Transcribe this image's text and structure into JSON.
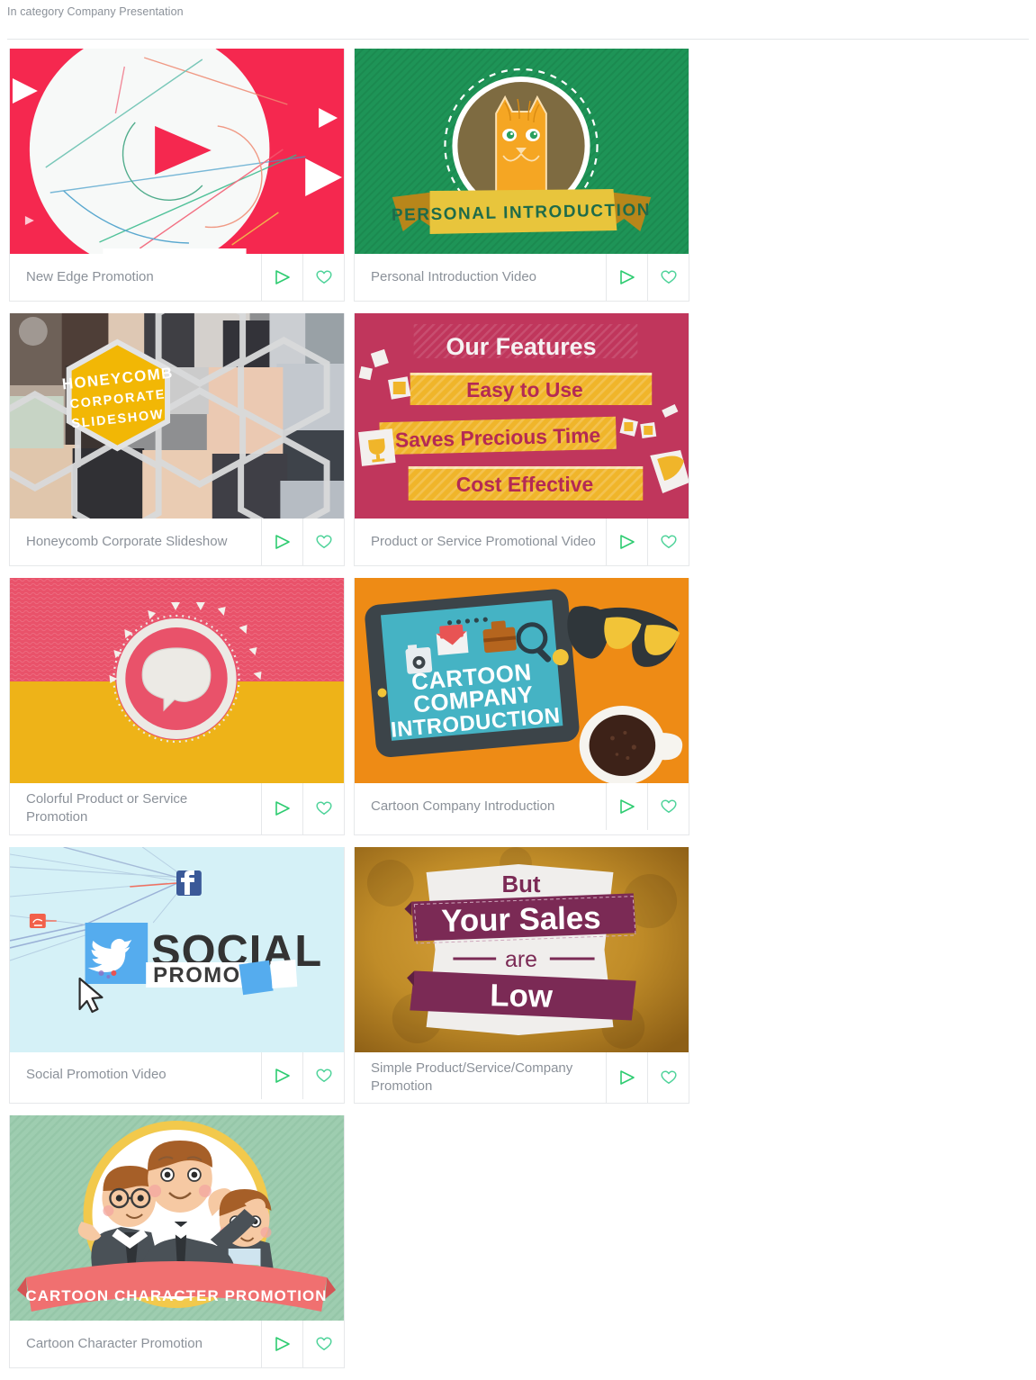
{
  "header": {
    "category_label": "In category Company Presentation"
  },
  "actions": {
    "play_icon": "play-icon",
    "favorite_icon": "heart-icon",
    "play_color": "#2ecc71",
    "heart_color": "#4fd39a"
  },
  "theme": {
    "title_color": "#8b9199",
    "border_color": "#e6e8ea",
    "background": "#ffffff"
  },
  "cards": [
    {
      "title": "New Edge Promotion",
      "art": "new-edge-promotion-thumbnail",
      "colors": {
        "bg": "#f5284f",
        "circle": "#f7f9f8",
        "play": "#f5284f"
      },
      "art_text": []
    },
    {
      "title": "Personal Introduction Video",
      "art": "personal-introduction-thumbnail",
      "colors": {
        "bg": "#1e9457",
        "disc": "#7e6b41",
        "cat": "#f5a623",
        "banner": "#e8c53c"
      },
      "art_text": [
        "PERSONAL INTRODUCTION"
      ]
    },
    {
      "title": "Honeycomb Corporate Slideshow",
      "art": "honeycomb-corporate-thumbnail",
      "colors": {
        "bg": "#8d8f92",
        "hex": "#f2b705",
        "cell_border": "#d9dadb"
      },
      "art_text": [
        "HONEYCOMB",
        "CORPORATE",
        "SLIDESHOW"
      ]
    },
    {
      "title": "Product or Service Promotional Video",
      "art": "product-service-promotional-thumbnail",
      "colors": {
        "bg": "#c0365c",
        "bar": "#f0b52a",
        "heading": "#f4f1f2",
        "bar_text": "#b42a54"
      },
      "art_text": [
        "Our Features",
        "Easy to Use",
        "Saves Precious Time",
        "Cost Effective"
      ]
    },
    {
      "title": "Colorful Product or Service Promotion",
      "art": "colorful-product-service-thumbnail",
      "colors": {
        "top": "#e9526a",
        "bottom": "#eeb318",
        "ring": "#eceae5",
        "bubble": "#e8e7e2"
      },
      "art_text": []
    },
    {
      "title": "Cartoon Company Introduction",
      "art": "cartoon-company-introduction-thumbnail",
      "colors": {
        "bg": "#ee8b15",
        "tablet": "#3c4449",
        "screen": "#45b3c4",
        "coffee": "#3d2218"
      },
      "art_text": [
        "CARTOON",
        "COMPANY",
        "INTRODUCTION"
      ]
    },
    {
      "title": "Social Promotion Video",
      "art": "social-promotion-thumbnail",
      "colors": {
        "bg": "#d5f1f7",
        "twitter": "#55acee",
        "facebook": "#3b5998",
        "text": "#333333"
      },
      "art_text": [
        "SOCIAL",
        "PROMO"
      ]
    },
    {
      "title": "Simple Product/Service/Company Promotion",
      "art": "simple-product-service-company-thumbnail",
      "colors": {
        "bg": "#c8922c",
        "panel": "#f0eeec",
        "ribbon": "#7b2a55",
        "text": "#ffffff"
      },
      "art_text": [
        "But",
        "Your Sales",
        "are",
        "Low"
      ]
    },
    {
      "title": "Cartoon Character Promotion",
      "art": "cartoon-character-promotion-thumbnail",
      "colors": {
        "bg": "#9ecdb0",
        "ring": "#f2c94c",
        "disc": "#ffffff",
        "ribbon": "#f07070"
      },
      "art_text": [
        "CARTOON CHARACTER PROMOTION"
      ]
    }
  ]
}
